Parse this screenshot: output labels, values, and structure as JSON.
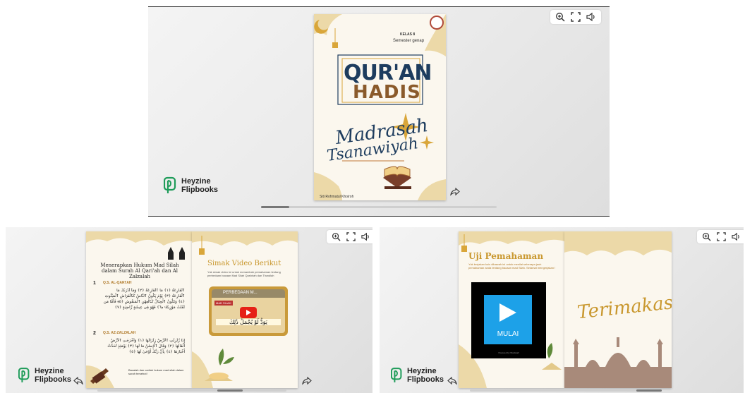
{
  "brand": {
    "line1": "Heyzine",
    "line2": "Flipbooks",
    "logo_color": "#1f9c5a"
  },
  "top": {
    "cover": {
      "kelas": "KELAS 8",
      "semester": "Semester genap",
      "title1": "QUR'AN",
      "title2": "HADIS",
      "script1": "Madrasah",
      "script2": "Tsanawiyah",
      "author": "Siti Rohmatul Khoiroh",
      "title_color": "#1d3c5e",
      "title2_color": "#8a5a2b"
    }
  },
  "left": {
    "page1": {
      "heading": "Menerapkan Hukum Mad Silah dalam Surah Al Qari'ah dan Al Zalzalah",
      "sec1_num": "1",
      "sec1_title": "Q.S. AL-QARI'AH",
      "sec1_arabic": "ٱلْقَارِعَةُ ﴿١﴾ مَا ٱلْقَارِعَةُ ﴿٢﴾ وَمَآ أَدْرَىٰكَ مَا ٱلْقَارِعَةُ ﴿٣﴾ يَوْمَ يَكُونُ ٱلنَّاسُ كَٱلْفَرَاشِ ٱلْمَبْثُوثِ ﴿٤﴾ وَتَكُونُ ٱلْجِبَالُ كَٱلْعِهْنِ ٱلْمَنفُوشِ ﴿٥﴾ فَأَمَّا مَن ثَقُلَتْ مَوَٰزِينُهُۥ ﴿٦﴾ فَهُوَ فِى عِيشَةٍ رَّاضِيَةٍ ﴿٧﴾",
      "sec2_num": "2",
      "sec2_title": "Q.S. AZ-ZALZALAH",
      "sec2_arabic": "إِذَا زُلْزِلَتِ ٱلْأَرْضُ زِلْزَالَهَا ﴿١﴾ وَأَخْرَجَتِ ٱلْأَرْضُ أَثْقَالَهَا ﴿٢﴾ وَقَالَ ٱلْإِنسَٰنُ مَا لَهَا ﴿٣﴾ يَوْمَئِذٍ تُحَدِّثُ أَخْبَارَهَا ﴿٤﴾ بِأَنَّ رَبَّكَ أَوْحَىٰ لَهَا ﴿٥﴾",
      "footnote": "Bacalah dan carilah hukum mad silah dalam surah tersebut!"
    },
    "page2": {
      "heading": "Simak Video Berikut",
      "subtext": "Yuk simak video ini untuk menambah pemahaman tentang perbedaan bacaan Mad Silah Qashirah dan Thawilah",
      "video_title": "PERBEDAAN M...",
      "video_label": "MAD SILAH",
      "video_arabic": "يَوَدُّ لَوْ يُجْمَلُ ذَٰلِكَ"
    }
  },
  "right": {
    "page1": {
      "heading": "Uji Pemahaman",
      "subtext": "Yuk kerjakan kuis dibawah ini untuk menilai seberapa jauh pemahaman anda tentang bacaan mad Silah. Selamat mengerjakan !",
      "play_label": "MULAI",
      "caption": "Powered by Wordwall"
    },
    "page2": {
      "script": "Terimakasih"
    }
  },
  "colors": {
    "gold": "#d9a63a",
    "gold_light": "#ecd9a8",
    "page": "#fbf7ee",
    "tile": "#1da1e8",
    "mosque": "#a88a7a"
  }
}
